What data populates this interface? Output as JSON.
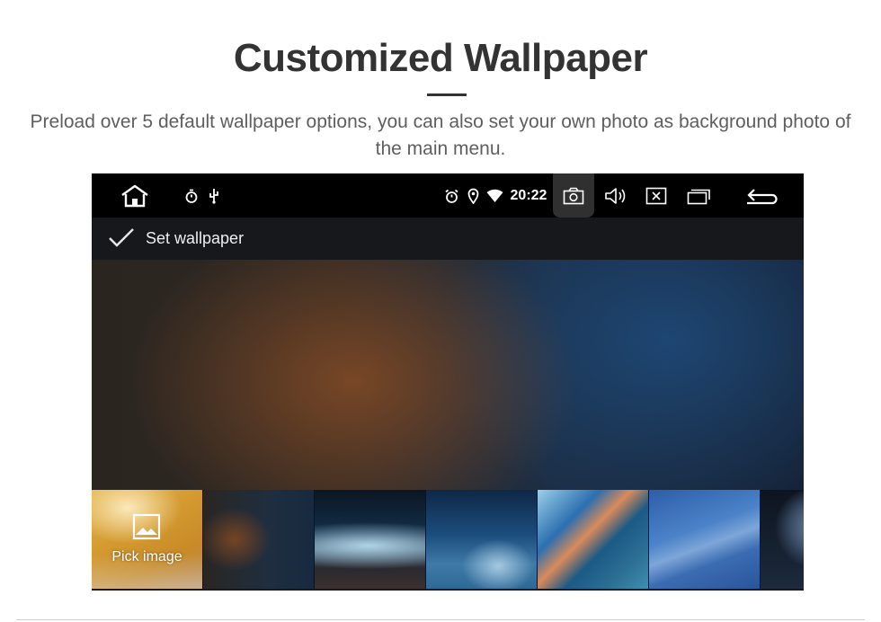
{
  "header": {
    "title": "Customized Wallpaper",
    "subtitle": "Preload over 5 default wallpaper options, you can also set your own photo as background photo of the main menu."
  },
  "statusbar": {
    "time": "20:22",
    "icons": [
      "home-icon",
      "timer-icon",
      "usb-icon",
      "alarm-icon",
      "location-icon",
      "wifi-icon",
      "camera-icon",
      "volume-icon",
      "close-app-icon",
      "recent-apps-icon",
      "back-icon"
    ]
  },
  "actionbar": {
    "label": "Set wallpaper"
  },
  "thumbnails": {
    "pick_label": "Pick image",
    "items": [
      "pick-image",
      "wallpaper-brown-blue",
      "wallpaper-earth-aurora",
      "wallpaper-starry-earth",
      "wallpaper-wave",
      "wallpaper-blue-abstract",
      "wallpaper-planet"
    ]
  },
  "colors": {
    "title": "#333333",
    "subtitle": "#5e5e5e",
    "statusbar_bg": "#000000"
  }
}
